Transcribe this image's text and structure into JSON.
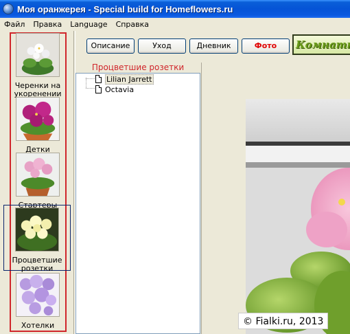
{
  "window": {
    "title": "Моя оранжерея - Special build for Homeflowers.ru"
  },
  "menu": [
    {
      "label": "Файл"
    },
    {
      "label": "Правка"
    },
    {
      "label": "Language"
    },
    {
      "label": "Справка"
    }
  ],
  "categories": [
    {
      "label": "Черенки на укоренении",
      "icon": "violet-cuttings-thumb",
      "selected": false
    },
    {
      "label": "Детки",
      "icon": "violet-plantlet-thumb",
      "selected": false
    },
    {
      "label": "Стартеры",
      "icon": "violet-starter-thumb",
      "selected": false
    },
    {
      "label": "Процветшие розетки",
      "icon": "violet-blooming-rosette-thumb",
      "selected": true
    },
    {
      "label": "Хотелки",
      "icon": "violet-wishlist-thumb",
      "selected": false
    }
  ],
  "toolbar": {
    "buttons": [
      {
        "label": "Описание"
      },
      {
        "label": "Уход"
      },
      {
        "label": "Дневник"
      },
      {
        "label": "Фото",
        "active": true
      }
    ],
    "banner_text": "Комнатные"
  },
  "tree": {
    "header": "Процветшие розетки",
    "items": [
      {
        "label": "Lilian Jarrett",
        "selected": true
      },
      {
        "label": "Octavia",
        "selected": false
      }
    ]
  },
  "photo": {
    "copyright": "© Fialki.ru, 2013"
  },
  "colors": {
    "accent_red": "#d0262b",
    "titlebar_blue": "#0553d6"
  }
}
